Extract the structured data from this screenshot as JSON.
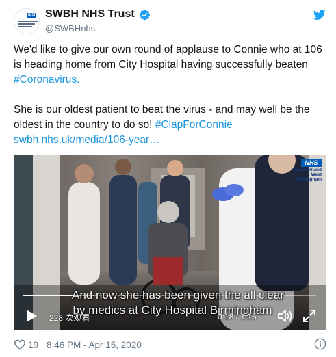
{
  "account": {
    "name": "SWBH NHS Trust",
    "handle": "@SWBHnhs",
    "avatar_badge": "NHS"
  },
  "tweet": {
    "line1_text": "We'd like to give our own round of applause to Connie who at 106 is heading home from City Hospital having successfully beaten ",
    "line1_hashtag": "#Coronavirus.",
    "line2_text": "She is our oldest patient to beat the virus - and may well be the oldest in the country to do so! ",
    "line2_hashtag": "#ClapForConnie",
    "link": "swbh.nhs.uk/media/106-year…"
  },
  "video": {
    "caption_line1": "And now she has been given the all clear",
    "caption_line2": "by medics at City Hospital Birmingham",
    "views": "228 次观看",
    "time": "0:18 / 1:15",
    "progress_fraction": 0.24,
    "logo_badge": "NHS",
    "logo_org_line1": "Sandwell and",
    "logo_org_line2": "West Birmingham",
    "icons": [
      "play-icon",
      "volume-icon",
      "fullscreen-icon"
    ]
  },
  "footer": {
    "likes": "19",
    "timestamp": "8:46 PM - Apr 15, 2020"
  },
  "colors": {
    "link": "#1b95e0",
    "muted": "#657786",
    "text": "#14171a",
    "twitter_blue": "#1da1f2",
    "nhs_blue": "#005eb8"
  }
}
